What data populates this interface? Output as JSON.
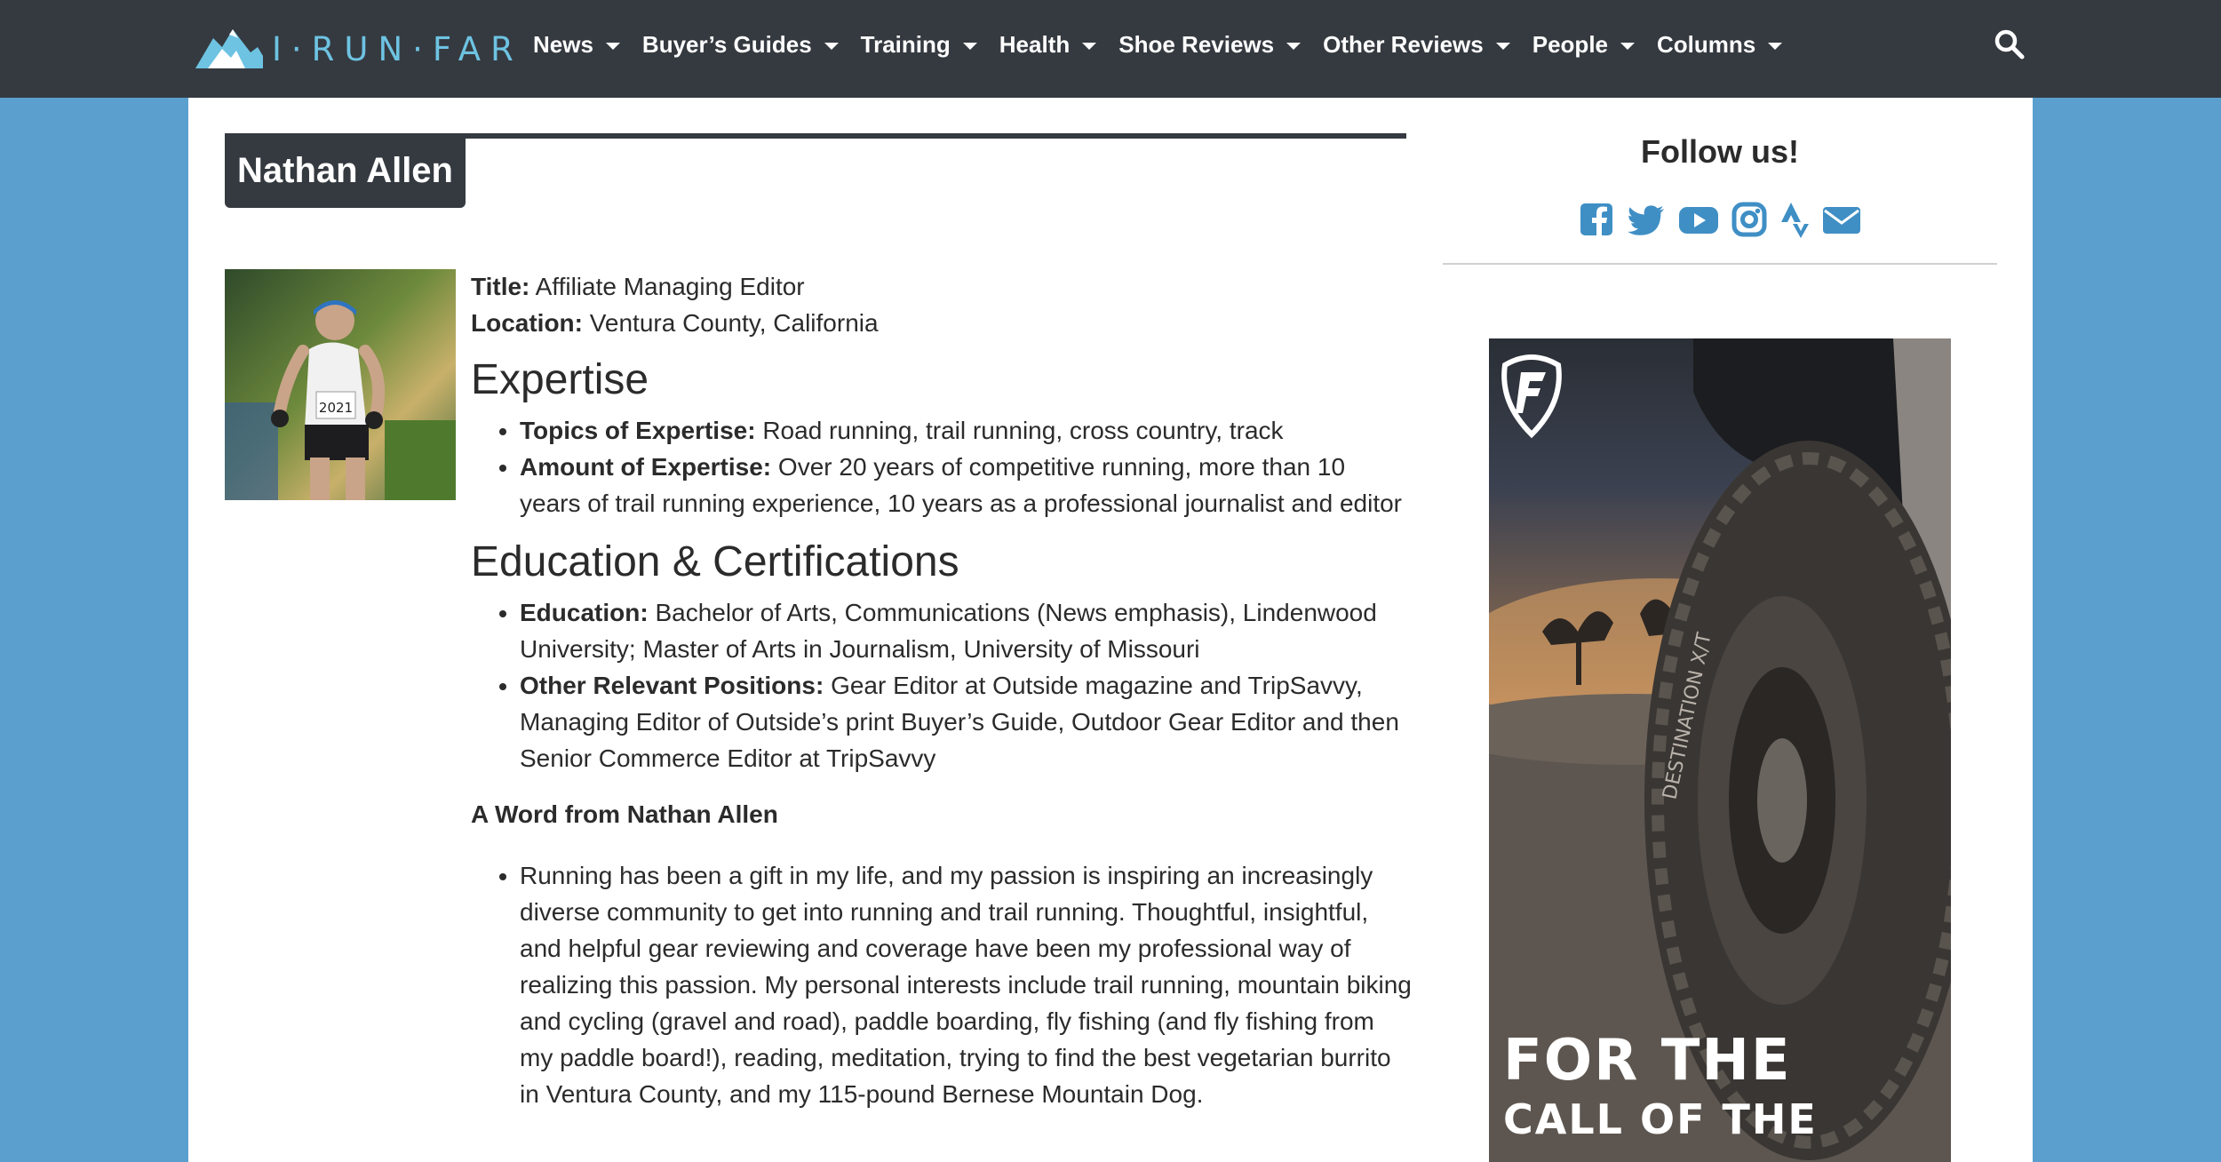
{
  "header": {
    "logo_text": "I·RUN·FAR",
    "nav": [
      {
        "label": "News"
      },
      {
        "label": "Buyer’s Guides"
      },
      {
        "label": "Training"
      },
      {
        "label": "Health"
      },
      {
        "label": "Shoe Reviews"
      },
      {
        "label": "Other Reviews"
      },
      {
        "label": "People"
      },
      {
        "label": "Columns"
      }
    ]
  },
  "profile": {
    "name": "Nathan Allen",
    "title_label": "Title:",
    "title_value": "Affiliate Managing Editor",
    "location_label": "Location:",
    "location_value": "Ventura County, California",
    "expertise_heading": "Expertise",
    "expertise": [
      {
        "label": "Topics of Expertise:",
        "text": "Road running, trail running, cross country, track"
      },
      {
        "label": "Amount of Expertise:",
        "text": "Over 20 years of competitive running, more than 10 years of trail running experience, 10 years as a professional journalist and editor"
      }
    ],
    "education_heading": "Education & Certifications",
    "education": [
      {
        "label": "Education:",
        "text": "Bachelor of Arts, Communications (News emphasis), Lindenwood University; Master of Arts in Journalism, University of Missouri"
      },
      {
        "label": "Other Relevant Positions:",
        "text": "Gear Editor at Outside magazine and TripSavvy, Managing Editor of Outside’s print Buyer’s Guide, Outdoor Gear Editor and then Senior Commerce Editor at TripSavvy"
      }
    ],
    "word_heading": "A Word from Nathan Allen",
    "word": "Running has been a gift in my life, and my passion is inspiring an increasingly diverse community to get into running and trail running. Thoughtful, insightful, and helpful gear reviewing and coverage have been my professional way of realizing this passion. My personal interests include trail running, mountain biking and cycling (gravel and road), paddle boarding, fly fishing (and fly fishing from my paddle board!), reading, meditation, trying to find the best vegetarian burrito in Ventura County, and my 115-pound Bernese Mountain Dog.",
    "photo_bib": "2021"
  },
  "sidebar": {
    "follow_title": "Follow us!",
    "socials": [
      "facebook-icon",
      "twitter-icon",
      "youtube-icon",
      "instagram-icon",
      "strava-icon",
      "email-icon"
    ]
  },
  "ad": {
    "line1": "FOR THE",
    "line2": "CALL OF THE",
    "tire_text": "DESTINATION X/T"
  },
  "colors": {
    "nav_bg": "#353a40",
    "page_bg": "#5b9fcf",
    "brand_blue": "#6ec3e2",
    "social_blue": "#3f8fc5"
  }
}
